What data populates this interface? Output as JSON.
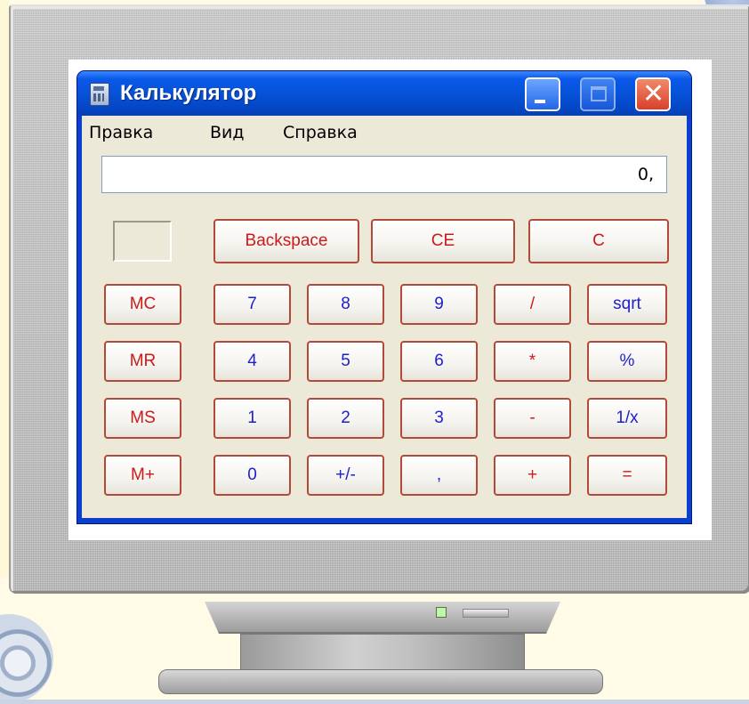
{
  "window": {
    "title": "Калькулятор"
  },
  "menu": [
    "Правка",
    "Вид",
    "Справка"
  ],
  "display": {
    "value": "0,"
  },
  "keys": {
    "backspace": "Backspace",
    "ce": "CE",
    "c": "C",
    "mc": "MC",
    "mr": "MR",
    "ms": "MS",
    "mplus": "M+",
    "d7": "7",
    "d8": "8",
    "d9": "9",
    "d4": "4",
    "d5": "5",
    "d6": "6",
    "d1": "1",
    "d2": "2",
    "d3": "3",
    "d0": "0",
    "sign": "+/-",
    "decimal": ",",
    "divide": "/",
    "multiply": "*",
    "subtract": "-",
    "add": "+",
    "sqrt": "sqrt",
    "percent": "%",
    "reciprocal": "1/x",
    "equals": "="
  },
  "colors": {
    "title_bar": "#0652d8",
    "window_face": "#ece9d8",
    "digit_text": "#1e1ecc",
    "operator_text": "#cc1a1a"
  },
  "icons": {
    "app": "calculator-icon",
    "minimize": "minimize-icon",
    "maximize": "maximize-icon",
    "close": "close-icon"
  }
}
